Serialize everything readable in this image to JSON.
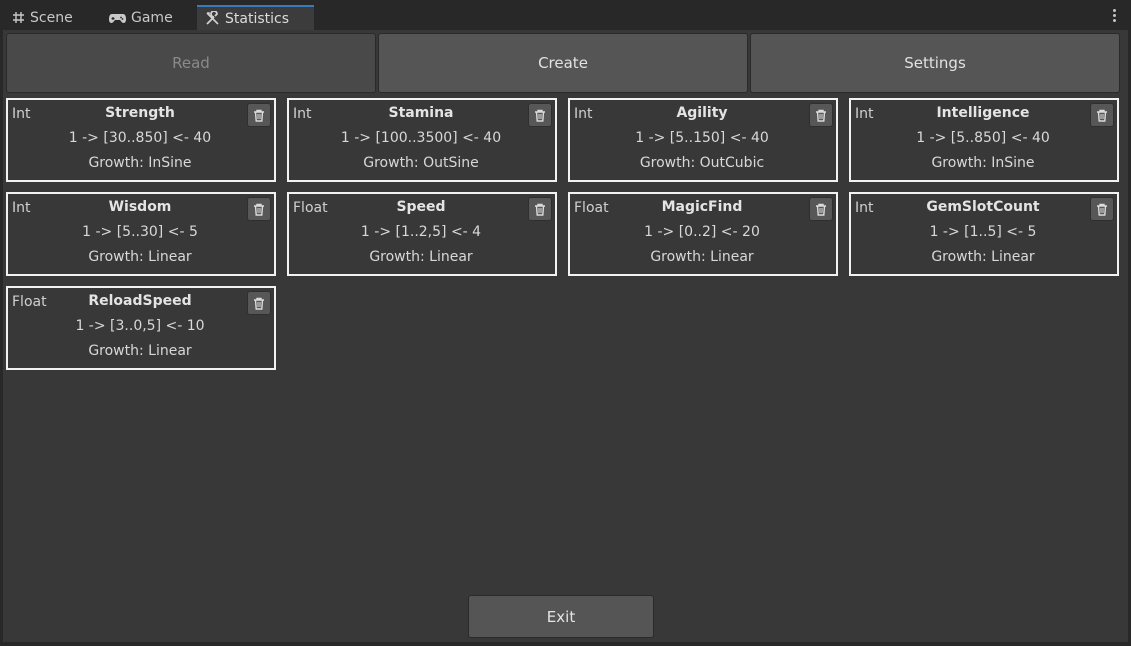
{
  "tabs": [
    {
      "label": "Scene",
      "icon": "grid-icon"
    },
    {
      "label": "Game",
      "icon": "gamepad-icon"
    },
    {
      "label": "Statistics",
      "icon": "tools-icon"
    }
  ],
  "toolbar": {
    "read_label": "Read",
    "create_label": "Create",
    "settings_label": "Settings"
  },
  "stats": [
    {
      "type": "Int",
      "name": "Strength",
      "range": "1 -> [30..850] <- 40",
      "growth": "Growth: InSine"
    },
    {
      "type": "Int",
      "name": "Stamina",
      "range": "1 -> [100..3500] <- 40",
      "growth": "Growth: OutSine"
    },
    {
      "type": "Int",
      "name": "Agility",
      "range": "1 -> [5..150] <- 40",
      "growth": "Growth: OutCubic"
    },
    {
      "type": "Int",
      "name": "Intelligence",
      "range": "1 -> [5..850] <- 40",
      "growth": "Growth: InSine"
    },
    {
      "type": "Int",
      "name": "Wisdom",
      "range": "1 -> [5..30] <- 5",
      "growth": "Growth: Linear"
    },
    {
      "type": "Float",
      "name": "Speed",
      "range": "1 -> [1..2,5] <- 4",
      "growth": "Growth: Linear"
    },
    {
      "type": "Float",
      "name": "MagicFind",
      "range": "1 -> [0..2] <- 20",
      "growth": "Growth: Linear"
    },
    {
      "type": "Int",
      "name": "GemSlotCount",
      "range": "1 -> [1..5] <- 5",
      "growth": "Growth: Linear"
    },
    {
      "type": "Float",
      "name": "ReloadSpeed",
      "range": "1 -> [3..0,5] <- 10",
      "growth": "Growth: Linear"
    }
  ],
  "footer": {
    "exit_label": "Exit"
  },
  "colors": {
    "accent": "#3a79bb",
    "card_border": "#f2f2f2",
    "button": "#555555"
  }
}
